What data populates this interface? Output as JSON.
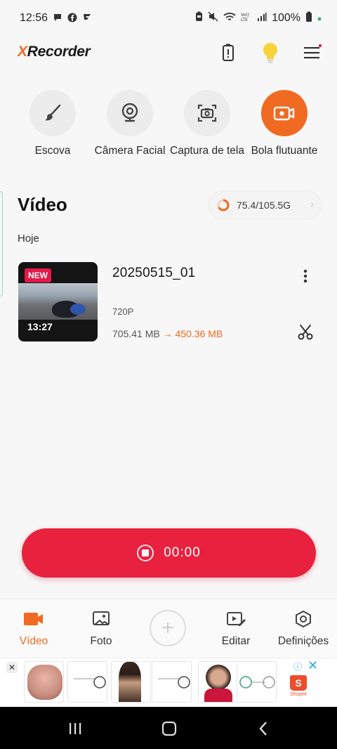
{
  "status_bar": {
    "time": "12:56",
    "battery": "100%",
    "left_icons": [
      "chat-bubble-icon",
      "facebook-icon",
      "flash-app-icon"
    ],
    "right_icons": [
      "battery-saver-icon",
      "mute-icon",
      "wifi-icon",
      "volte-icon",
      "signal-icon",
      "battery-icon"
    ]
  },
  "app": {
    "logo_x": "X",
    "logo_rest": "Recorder",
    "brand_color": "#f06a22",
    "accent_red": "#e8213f"
  },
  "tools": [
    {
      "label": "Escova",
      "icon": "brush-icon"
    },
    {
      "label": "Câmera Facial",
      "icon": "webcam-icon"
    },
    {
      "label": "Captura de tela",
      "icon": "screenshot-camera-icon"
    },
    {
      "label": "Bola flutuante",
      "icon": "floating-ball-icon"
    }
  ],
  "section": {
    "title": "Vídeo",
    "storage_text": "75.4/105.5G",
    "date_group": "Hoje"
  },
  "video": {
    "badge": "NEW",
    "duration": "13:27",
    "title": "20250515_01",
    "resolution": "720P",
    "size_before": "705.41 MB",
    "arrow": "→",
    "size_after": "450.36 MB"
  },
  "record": {
    "timer": "00:00"
  },
  "bottom_nav": {
    "video": "Vídeo",
    "photo": "Foto",
    "edit": "Editar",
    "settings": "Definições"
  },
  "ad": {
    "close": "✕",
    "info": "ⓘ",
    "dismiss": "✕",
    "advertiser": "Shopee",
    "bag_letter": "S"
  }
}
